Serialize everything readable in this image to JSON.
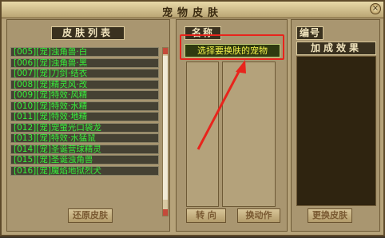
{
  "window": {
    "title": "宠物皮肤",
    "close_label": "×"
  },
  "left_panel": {
    "header": "皮肤列表",
    "items": [
      "[005][宠]浊角兽·白",
      "[006][宠]浊角兽·黑",
      "[007][宠]刀剑·结衣",
      "[008][宠]精灵风·改",
      "[009][宠]特效·风精",
      "[010][宠]特效·水精",
      "[011][宠]特效·地精",
      "[012][宠]宠萤光口袋龙",
      "[013][宠]特效·水猛鼠",
      "[014][宠]圣诞营球精灵",
      "[015][宠]圣诞浊角兽",
      "[016][宠]魔焰地狱烈犬"
    ],
    "restore_button": "还原皮肤"
  },
  "middle_panel": {
    "header": "名称",
    "slot_text": "选择要换肤的宠物",
    "turn_button": "转 向",
    "action_button": "换动作"
  },
  "right_panel": {
    "number_header": "编号",
    "bonus_header": "加成效果",
    "change_button": "更换皮肤"
  },
  "colors": {
    "list_text": "#37f03a",
    "highlight": "#e8241c",
    "slot_text": "#f3f04a"
  }
}
